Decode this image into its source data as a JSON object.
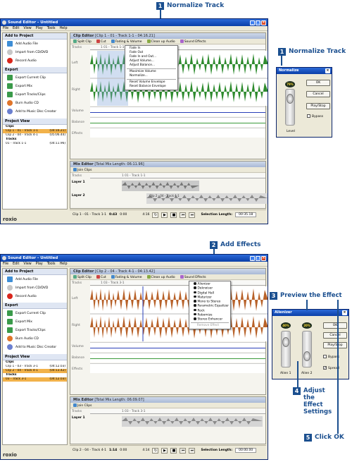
{
  "callouts": {
    "c1_top": {
      "num": "1",
      "text": "Normalize Track"
    },
    "c1_side": {
      "num": "1",
      "text": "Normalize Track"
    },
    "c2": {
      "num": "2",
      "text": "Add Effects"
    },
    "c3": {
      "num": "3",
      "text": "Preview the Effect"
    },
    "c4": {
      "num": "4",
      "text": "Adjust the Effect Settings"
    },
    "c5": {
      "num": "5",
      "text": "Click OK"
    }
  },
  "app": {
    "title": "Sound Editor - Untitled",
    "menu": [
      "File",
      "Edit",
      "View",
      "Play",
      "Tools",
      "Help"
    ],
    "add_to_project": "Add to Project",
    "add_items": [
      "Add Audio File",
      "Import from CD/DVD",
      "Record Audio"
    ],
    "export": "Export",
    "export_items": [
      "Export Current Clip",
      "Export Mix",
      "Export Tracks/Clips",
      "Burn Audio CD",
      "Add to Music Disc Creator"
    ],
    "project_view": "Project View",
    "brand": "roxio"
  },
  "shot1": {
    "clips_label": "Clips",
    "clips": [
      {
        "name": "Clip 1 - 01 - Track 1-1",
        "len": "(04:16.21)"
      },
      {
        "name": "Clip 2 - 04 - Track 4-1",
        "len": "(05:06.44)"
      }
    ],
    "tracks_label": "Tracks",
    "tracks": [
      {
        "name": "01 - Track 1-1",
        "len": "(04:11.96)"
      }
    ],
    "clip_editor_title": "Clip Editor",
    "clip_editor_sub": "[Clip 1 - 01 - Track 1-1 - 04:16.21]",
    "toolbar": [
      "Split Clip",
      "Cut",
      "Fading & Volume",
      "Clean up Audio",
      "Sound Effects"
    ],
    "lanes": [
      "Tracks",
      "Left",
      "Right",
      "Volume",
      "Balance",
      "Effects"
    ],
    "clip_tag": "1 01 - Track 1-1",
    "menu": [
      "Fade In",
      "Fade Out",
      "Fade In and Out...",
      "Adjust Volume...",
      "Adjust Balance...",
      "Maximize Volume",
      "Normalize...",
      "Reset Volume Envelope",
      "Reset Balance Envelope"
    ],
    "mix_title": "Mix Editor",
    "mix_sub": "[Total Mix Length: 06:11.96]",
    "join": "Join Clips",
    "tracks_lbl": "Tracks",
    "layer1": "Layer 1",
    "layer2": "Layer 2",
    "mix_clip_a": "1 01 - Track 1-1",
    "mix_clip_b": "Clip 2 - 04 - Track 4-1",
    "transport_clip": "Clip 1 - 01 - Track 1-1",
    "time": "0:43",
    "time_left": "0:00",
    "time_right": "4:16",
    "sel_len_label": "Selection Length:",
    "sel_len": "00:35.18"
  },
  "shot2": {
    "clips_label": "Clips",
    "clips": [
      {
        "name": "Clip 1 - 03 - Track 3-1",
        "len": "(04:12.03)"
      },
      {
        "name": "Clip 2 - 04 - Track 4-1",
        "len": "(04:13.42)"
      }
    ],
    "tracks_label": "Tracks",
    "tracks": [
      {
        "name": "03 - Track 3-1",
        "len": "(04:12.03)"
      }
    ],
    "clip_editor_title": "Clip Editor",
    "clip_editor_sub": "[Clip 2 - 04 - Track 4-1 - 04:13.42]",
    "toolbar": [
      "Split Clip",
      "Cut",
      "Fading & Volume",
      "Clean up Audio",
      "Sound Effects"
    ],
    "lanes": [
      "Tracks",
      "Left",
      "Right",
      "Volume",
      "Balance",
      "Effects"
    ],
    "clip_tag": "1 03 - Track 3-1",
    "menu": [
      "Alienizer",
      "Deknoiser",
      "Digital Hall",
      "Maturizer",
      "Mono to Stereo",
      "Parametric Equalizer",
      "Rock",
      "Robomize",
      "Stereo Enhancer",
      "Remove Effect"
    ],
    "mix_title": "Mix Editor",
    "mix_sub": "[Total Mix Length: 06:09.07]",
    "join": "Join Clips",
    "tracks_lbl": "Tracks",
    "layer1": "Layer 1",
    "mix_clip_a": "1 03 - Track 3-1",
    "transport_clip": "Clip 2 - 04 - Track 4-1",
    "time": "1:14",
    "time_left": "0:00",
    "time_right": "4:14",
    "sel_len_label": "Selection Length:",
    "sel_len": "00:00.00"
  },
  "normalize_dlg": {
    "title": "Normalize",
    "level_value": "79%",
    "level_label": "Level",
    "ok": "OK",
    "cancel": "Cancel",
    "play": "Play/Stop",
    "bypass": "Bypass"
  },
  "alienizer_dlg": {
    "title": "Alienizer",
    "knob1": "40%",
    "knob2": "20%",
    "label1": "Alien 1",
    "label2": "Alien 2",
    "ok": "OK",
    "cancel": "Cancel",
    "play": "Play/Stop",
    "bypass": "Bypass",
    "spread": "Spread"
  },
  "colors": {
    "wave_green": "#2e8b2e",
    "wave_orange": "#b8622a",
    "callout_blue": "#1b4f8f",
    "selected_row": "#f2b24a"
  }
}
